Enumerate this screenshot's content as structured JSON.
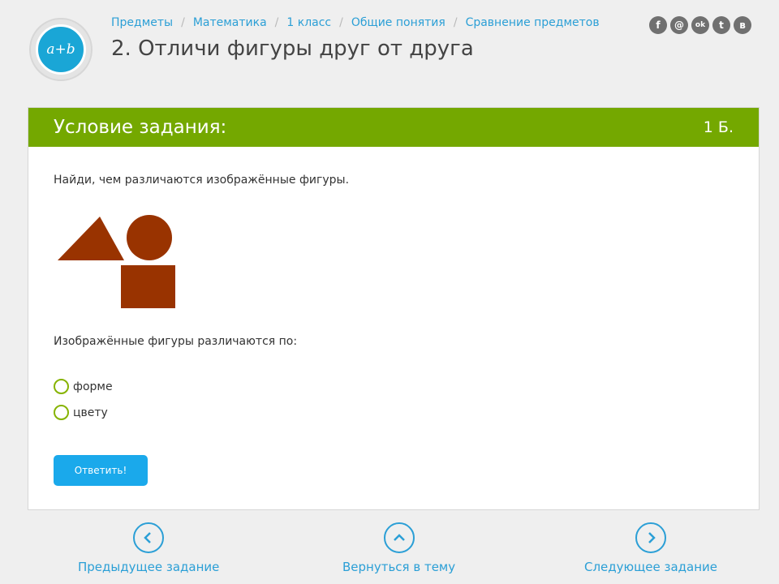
{
  "logo": {
    "text": "a+b"
  },
  "breadcrumb": [
    {
      "label": "Предметы"
    },
    {
      "label": "Математика"
    },
    {
      "label": "1 класс"
    },
    {
      "label": "Общие понятия"
    },
    {
      "label": "Сравнение предметов"
    }
  ],
  "page_title": "2. Отличи фигуры друг от друга",
  "socials": [
    {
      "icon": "facebook-icon",
      "glyph": "f"
    },
    {
      "icon": "mail-icon",
      "glyph": "@"
    },
    {
      "icon": "odnoklassniki-icon",
      "glyph": "ok"
    },
    {
      "icon": "twitter-icon",
      "glyph": "t"
    },
    {
      "icon": "vk-icon",
      "glyph": "в"
    }
  ],
  "task": {
    "header_title": "Условие задания:",
    "points": "1 Б.",
    "question": "Найди, чем различаются изображённые фигуры.",
    "sub_question": "Изображённые фигуры различаются по:",
    "options": [
      {
        "label": "форме"
      },
      {
        "label": "цвету"
      }
    ],
    "submit_label": "Ответить!",
    "shape_color": "#993300"
  },
  "nav": {
    "prev_label": "Предыдущее задание",
    "back_label": "Вернуться в тему",
    "next_label": "Следующее задание"
  },
  "colors": {
    "accent": "#2b9fd6",
    "header_green": "#74a800",
    "button_blue": "#1aa9eb"
  }
}
